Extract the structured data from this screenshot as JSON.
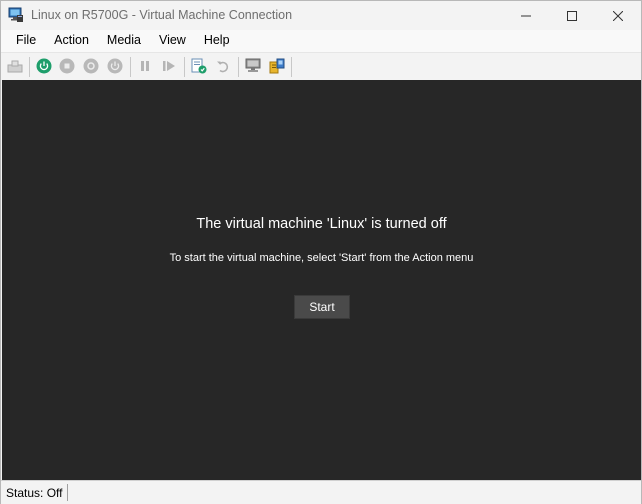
{
  "window": {
    "title": "Linux on R5700G - Virtual Machine Connection"
  },
  "menu": {
    "items": [
      "File",
      "Action",
      "Media",
      "View",
      "Help"
    ]
  },
  "toolbar": {
    "icons": [
      "ctrl-alt-del-icon",
      "start-icon",
      "turn-off-icon",
      "shut-down-icon",
      "power-icon",
      "pause-icon",
      "resume-icon",
      "checkpoint-icon",
      "revert-icon",
      "enhanced-session-icon",
      "share-icon"
    ]
  },
  "viewport": {
    "title": "The virtual machine 'Linux' is turned off",
    "hint": "To start the virtual machine, select 'Start' from the Action menu",
    "start_label": "Start"
  },
  "status": {
    "text": "Status: Off"
  },
  "colors": {
    "viewport_bg": "#272727",
    "accent_green": "#1e9e6b",
    "chrome_bg": "#f3f3f3"
  }
}
